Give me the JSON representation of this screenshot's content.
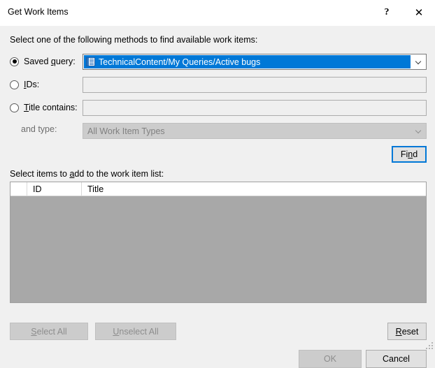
{
  "window": {
    "title": "Get Work Items",
    "help_icon": "question-mark-icon",
    "close_icon": "close-icon"
  },
  "instructions": "Select one of the following methods to find available work items:",
  "methods": {
    "saved_query": {
      "label_prefix": "Saved ",
      "label_mnemonic": "q",
      "label_suffix": "uery:",
      "selected": true,
      "value": "TechnicalContent/My Queries/Active bugs",
      "icon": "query-list-icon",
      "dropdown_icon": "chevron-down-icon",
      "highlight_color": "#0078d7"
    },
    "ids": {
      "label_mnemonic": "I",
      "label_suffix": "Ds:",
      "selected": false,
      "value": "",
      "placeholder": ""
    },
    "title_contains": {
      "label_mnemonic": "T",
      "label_suffix": "itle contains:",
      "selected": false,
      "value": "",
      "placeholder": ""
    },
    "and_type": {
      "label": "and type:",
      "value": "All Work Item Types",
      "enabled": false,
      "dropdown_icon": "chevron-down-icon"
    }
  },
  "find_button": {
    "label_prefix": "Fi",
    "label_mnemonic": "n",
    "label_suffix": "d",
    "focused": true
  },
  "list": {
    "label_prefix": "Select items to ",
    "label_mnemonic": "a",
    "label_suffix": "dd to the work item list:",
    "columns": [
      "",
      "ID",
      "Title"
    ],
    "rows": [],
    "empty_background": "#a8a8a8"
  },
  "buttons": {
    "select_all": {
      "label_mnemonic": "S",
      "label_suffix": "elect All",
      "enabled": false
    },
    "unselect_all": {
      "label_mnemonic": "U",
      "label_suffix": "nselect All",
      "enabled": false
    },
    "reset": {
      "label_mnemonic": "R",
      "label_suffix": "eset",
      "enabled": true
    },
    "ok": {
      "label": "OK",
      "enabled": false
    },
    "cancel": {
      "label": "Cancel",
      "enabled": true
    }
  },
  "resize_grip": "resize-grip-icon"
}
